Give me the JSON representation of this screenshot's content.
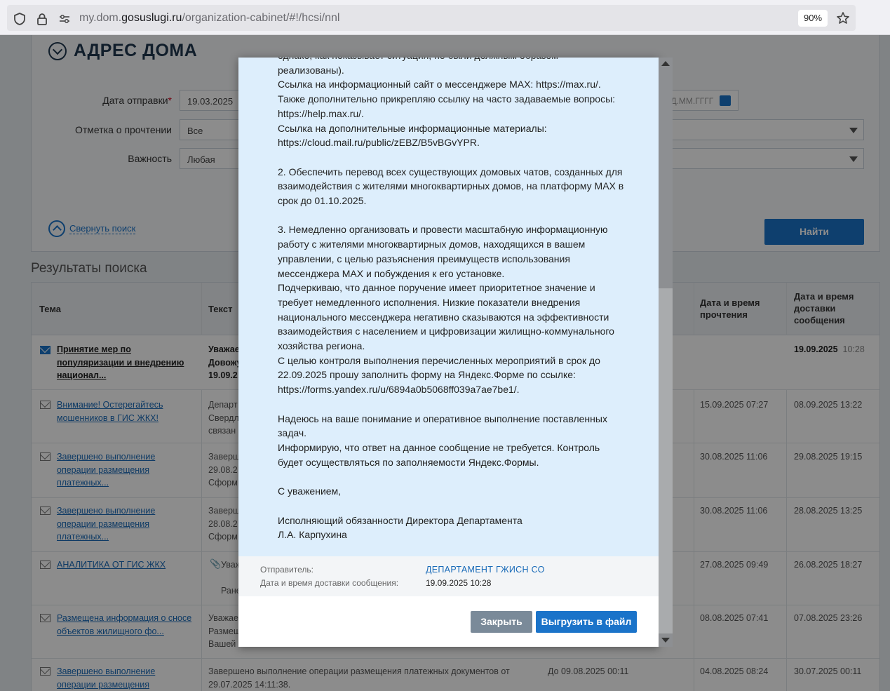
{
  "browser": {
    "url_prefix": "my.dom.",
    "url_domain": "gosuslugi.ru",
    "url_path": "/organization-cabinet/#!/hcsi/nnl",
    "zoom": "90%"
  },
  "search": {
    "section_title": "АДРЕС ДОМА",
    "date_label": "Дата отправки",
    "date_required_mark": "*",
    "date_value": "19.03.2025",
    "date_end_placeholder": "- ДД.ММ.ГГГГ",
    "read_mark_label": "Отметка о прочтении",
    "read_mark_value": "Все",
    "importance_label": "Важность",
    "importance_value": "Любая",
    "collapse_label": "Свернуть поиск",
    "find_label": "Найти"
  },
  "results": {
    "title": "Результаты поиска",
    "columns": {
      "topic": "Тема",
      "text": "Текст",
      "read_time": "Дата и время прочтения",
      "delivery_time": "Дата и время доставки сообщения"
    },
    "rows": [
      {
        "topic": "Принятие мер по популяризации и внедрению национал...",
        "text": "Уважае\nДовожу\n19.09.2",
        "read": "",
        "delivered_date": "19.09.2025",
        "delivered_time": "10:28",
        "unread": true
      },
      {
        "topic": "Внимание! Остерегайтесь мошенников в ГИС ЖКХ!",
        "text": "Департ\nСвердл\nсвязан",
        "read": "15.09.2025  07:27",
        "delivered": "08.09.2025  13:22",
        "unread": false
      },
      {
        "topic": "Завершено выполнение операции размещения платежных...",
        "text": "Заверш\n29.08.2\nСформ",
        "read": "30.08.2025  11:06",
        "delivered": "29.08.2025  19:15",
        "unread": false
      },
      {
        "topic": "Завершено выполнение операции размещения платежных...",
        "text": "Заверш\n28.08.2\nСформ",
        "read": "30.08.2025  11:06",
        "delivered": "28.08.2025  13:25",
        "unread": false
      },
      {
        "topic": "АНАЛИТИКА ОТ ГИС ЖКХ",
        "text": "Уваж\n\nРанее",
        "read": "27.08.2025  09:49",
        "delivered": "26.08.2025  18:27",
        "unread": false
      },
      {
        "topic": "Размещена информация о сносе объектов жилищного фо...",
        "text": "Уважае\nРазмещ\nВашей",
        "read": "08.08.2025  07:41",
        "delivered": "07.08.2025  23:26",
        "unread": false
      },
      {
        "topic": "Завершено выполнение операции размещения",
        "text": "Завершено выполнение операции размещения платежных документов от\n29.07.2025 14:11:38.",
        "deadline": "До 09.08.2025  00:11",
        "read": "04.08.2025  08:24",
        "delivered": "30.07.2025  00:11",
        "unread": false
      }
    ]
  },
  "modal": {
    "body": "однако, как показывает ситуация, не были должным образом\nреализованы).\nСсылка на информационный сайт о мессенджере MAX: https://max.ru/.\nТакже дополнительно прикрепляю ссылку на часто задаваемые вопросы:\nhttps://help.max.ru/.\nСсылка на дополнительные информационные материалы:\nhttps://cloud.mail.ru/public/zEBZ/B5vBGvYPR.\n\n2. Обеспечить перевод всех существующих домовых чатов, созданных для\nвзаимодействия с жителями многоквартирных домов, на платформу MAX в\nсрок до 01.10.2025.\n\n3. Немедленно организовать и провести масштабную информационную\nработу с жителями многоквартирных домов, находящихся в вашем\nуправлении, с целью разъяснения преимуществ использования\nмессенджера MAX и побуждения к его установке.\nПодчеркиваю, что данное поручение имеет приоритетное значение и\nтребует немедленного исполнения. Низкие показатели внедрения\nнационального мессенджера негативно сказываются на эффективности\nвзаимодействия с населением и цифровизации жилищно-коммунального\nхозяйства региона.\nС целью контроля выполнения перечисленных мероприятий в срок до\n22.09.2025 прошу заполнить форму на Яндекс.Форме по ссылке:\nhttps://forms.yandex.ru/u/6894a0b5068ff039a7ae7be1/.\n\nНадеюсь на ваше понимание и оперативное выполнение поставленных\nзадач.\nИнформирую, что ответ на данное сообщение не требуется. Контроль\nбудет осуществляться по заполняемости Яндекс.Формы.\n\nС уважением,\n\nИсполняющий обязанности Директора Департамента\nЛ.А. Карпухина",
    "sender_label": "Отправитель:",
    "sender_value": "ДЕПАРТАМЕНТ ГЖИСН СО",
    "delivery_label": "Дата и время доставки сообщения:",
    "delivery_value": "19.09.2025 10:28",
    "close_label": "Закрыть",
    "export_label": "Выгрузить в файл"
  }
}
